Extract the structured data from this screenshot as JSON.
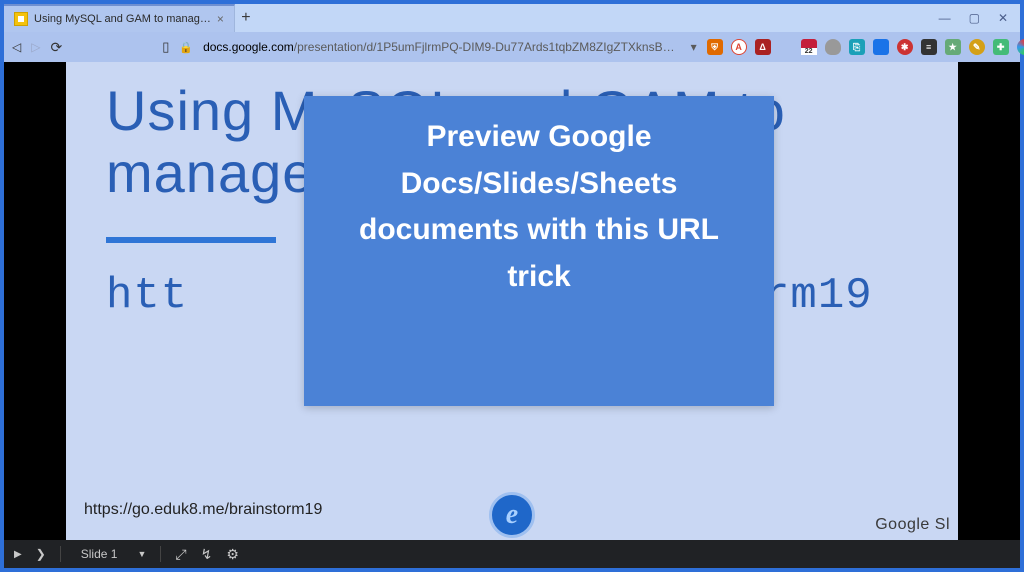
{
  "browser": {
    "tab_title": "Using MySQL and GAM to manag…",
    "new_tab_label": "+",
    "window_buttons": {
      "minimize": "—",
      "maximize": "▢",
      "close": "✕"
    },
    "nav": {
      "back": "◁",
      "forward": "▷",
      "reload": "⟳"
    },
    "bookmark_icon": "▯",
    "lock_icon": "🔒",
    "url_host": "docs.google.com",
    "url_path": "/presentation/d/1P5umFjlrmPQ-DIM9-Du77Ards1tqbZM8ZIgZTXknsB…",
    "extensions_count": 15,
    "cal_day": "22"
  },
  "slide": {
    "title_line1": "Using MySQL and GAM to",
    "title_line2": "manage G Suite accounts",
    "link_fragment_left": "htt",
    "link_fragment_right": "rm19",
    "footer_url": "https://go.eduk8.me/brainstorm19",
    "badge_letter": "e",
    "brand_text": "Google Sl"
  },
  "overlay": {
    "text": "Preview Google Docs/Slides/Sheets documents with this URL trick"
  },
  "presenter_bar": {
    "play": "▶",
    "next": "❯",
    "slide_label": "Slide 1",
    "expand": "⤢",
    "pointer": "↯",
    "settings": "⚙"
  },
  "chart_data": null
}
